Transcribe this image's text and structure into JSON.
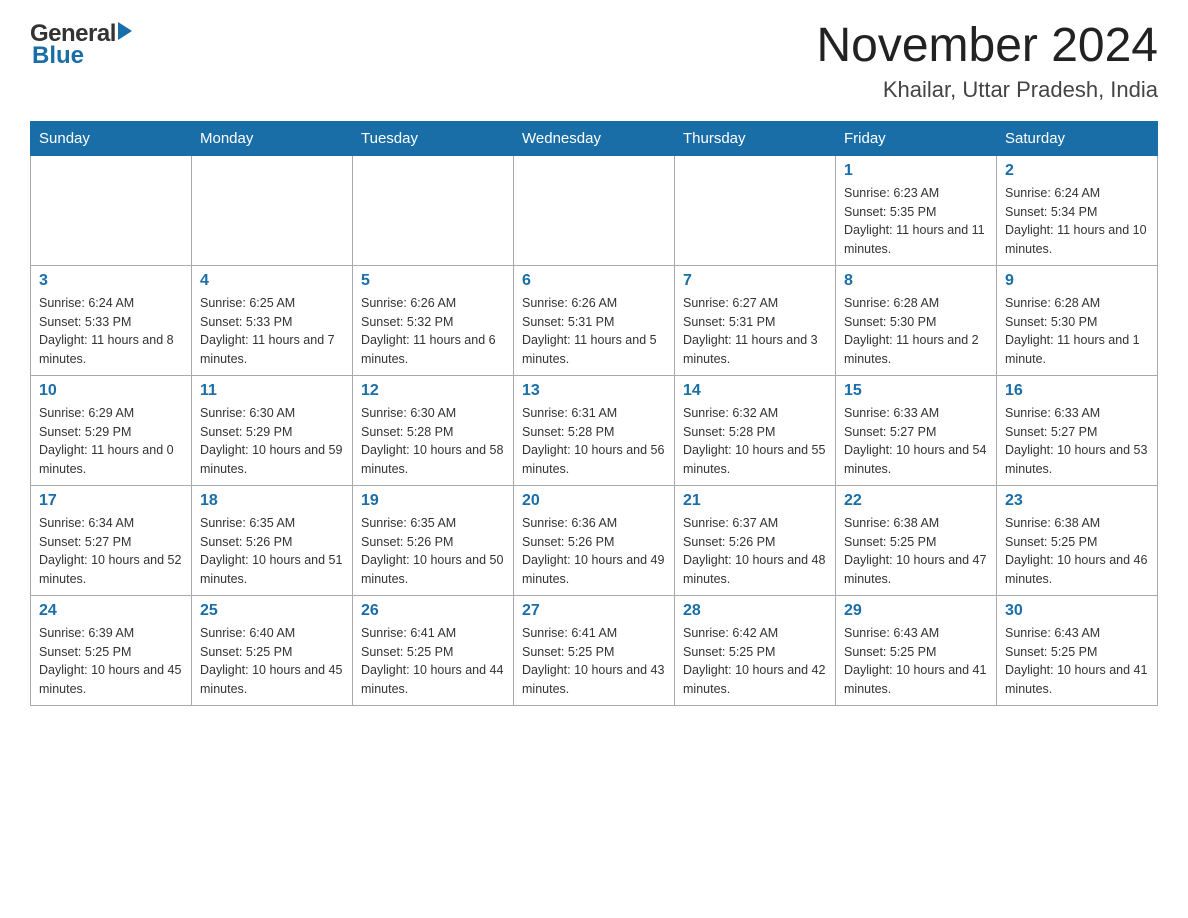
{
  "header": {
    "logo_general": "General",
    "logo_blue": "Blue",
    "month_title": "November 2024",
    "location": "Khailar, Uttar Pradesh, India"
  },
  "weekdays": [
    "Sunday",
    "Monday",
    "Tuesday",
    "Wednesday",
    "Thursday",
    "Friday",
    "Saturday"
  ],
  "weeks": [
    [
      {
        "day": "",
        "info": ""
      },
      {
        "day": "",
        "info": ""
      },
      {
        "day": "",
        "info": ""
      },
      {
        "day": "",
        "info": ""
      },
      {
        "day": "",
        "info": ""
      },
      {
        "day": "1",
        "info": "Sunrise: 6:23 AM\nSunset: 5:35 PM\nDaylight: 11 hours and 11 minutes."
      },
      {
        "day": "2",
        "info": "Sunrise: 6:24 AM\nSunset: 5:34 PM\nDaylight: 11 hours and 10 minutes."
      }
    ],
    [
      {
        "day": "3",
        "info": "Sunrise: 6:24 AM\nSunset: 5:33 PM\nDaylight: 11 hours and 8 minutes."
      },
      {
        "day": "4",
        "info": "Sunrise: 6:25 AM\nSunset: 5:33 PM\nDaylight: 11 hours and 7 minutes."
      },
      {
        "day": "5",
        "info": "Sunrise: 6:26 AM\nSunset: 5:32 PM\nDaylight: 11 hours and 6 minutes."
      },
      {
        "day": "6",
        "info": "Sunrise: 6:26 AM\nSunset: 5:31 PM\nDaylight: 11 hours and 5 minutes."
      },
      {
        "day": "7",
        "info": "Sunrise: 6:27 AM\nSunset: 5:31 PM\nDaylight: 11 hours and 3 minutes."
      },
      {
        "day": "8",
        "info": "Sunrise: 6:28 AM\nSunset: 5:30 PM\nDaylight: 11 hours and 2 minutes."
      },
      {
        "day": "9",
        "info": "Sunrise: 6:28 AM\nSunset: 5:30 PM\nDaylight: 11 hours and 1 minute."
      }
    ],
    [
      {
        "day": "10",
        "info": "Sunrise: 6:29 AM\nSunset: 5:29 PM\nDaylight: 11 hours and 0 minutes."
      },
      {
        "day": "11",
        "info": "Sunrise: 6:30 AM\nSunset: 5:29 PM\nDaylight: 10 hours and 59 minutes."
      },
      {
        "day": "12",
        "info": "Sunrise: 6:30 AM\nSunset: 5:28 PM\nDaylight: 10 hours and 58 minutes."
      },
      {
        "day": "13",
        "info": "Sunrise: 6:31 AM\nSunset: 5:28 PM\nDaylight: 10 hours and 56 minutes."
      },
      {
        "day": "14",
        "info": "Sunrise: 6:32 AM\nSunset: 5:28 PM\nDaylight: 10 hours and 55 minutes."
      },
      {
        "day": "15",
        "info": "Sunrise: 6:33 AM\nSunset: 5:27 PM\nDaylight: 10 hours and 54 minutes."
      },
      {
        "day": "16",
        "info": "Sunrise: 6:33 AM\nSunset: 5:27 PM\nDaylight: 10 hours and 53 minutes."
      }
    ],
    [
      {
        "day": "17",
        "info": "Sunrise: 6:34 AM\nSunset: 5:27 PM\nDaylight: 10 hours and 52 minutes."
      },
      {
        "day": "18",
        "info": "Sunrise: 6:35 AM\nSunset: 5:26 PM\nDaylight: 10 hours and 51 minutes."
      },
      {
        "day": "19",
        "info": "Sunrise: 6:35 AM\nSunset: 5:26 PM\nDaylight: 10 hours and 50 minutes."
      },
      {
        "day": "20",
        "info": "Sunrise: 6:36 AM\nSunset: 5:26 PM\nDaylight: 10 hours and 49 minutes."
      },
      {
        "day": "21",
        "info": "Sunrise: 6:37 AM\nSunset: 5:26 PM\nDaylight: 10 hours and 48 minutes."
      },
      {
        "day": "22",
        "info": "Sunrise: 6:38 AM\nSunset: 5:25 PM\nDaylight: 10 hours and 47 minutes."
      },
      {
        "day": "23",
        "info": "Sunrise: 6:38 AM\nSunset: 5:25 PM\nDaylight: 10 hours and 46 minutes."
      }
    ],
    [
      {
        "day": "24",
        "info": "Sunrise: 6:39 AM\nSunset: 5:25 PM\nDaylight: 10 hours and 45 minutes."
      },
      {
        "day": "25",
        "info": "Sunrise: 6:40 AM\nSunset: 5:25 PM\nDaylight: 10 hours and 45 minutes."
      },
      {
        "day": "26",
        "info": "Sunrise: 6:41 AM\nSunset: 5:25 PM\nDaylight: 10 hours and 44 minutes."
      },
      {
        "day": "27",
        "info": "Sunrise: 6:41 AM\nSunset: 5:25 PM\nDaylight: 10 hours and 43 minutes."
      },
      {
        "day": "28",
        "info": "Sunrise: 6:42 AM\nSunset: 5:25 PM\nDaylight: 10 hours and 42 minutes."
      },
      {
        "day": "29",
        "info": "Sunrise: 6:43 AM\nSunset: 5:25 PM\nDaylight: 10 hours and 41 minutes."
      },
      {
        "day": "30",
        "info": "Sunrise: 6:43 AM\nSunset: 5:25 PM\nDaylight: 10 hours and 41 minutes."
      }
    ]
  ]
}
